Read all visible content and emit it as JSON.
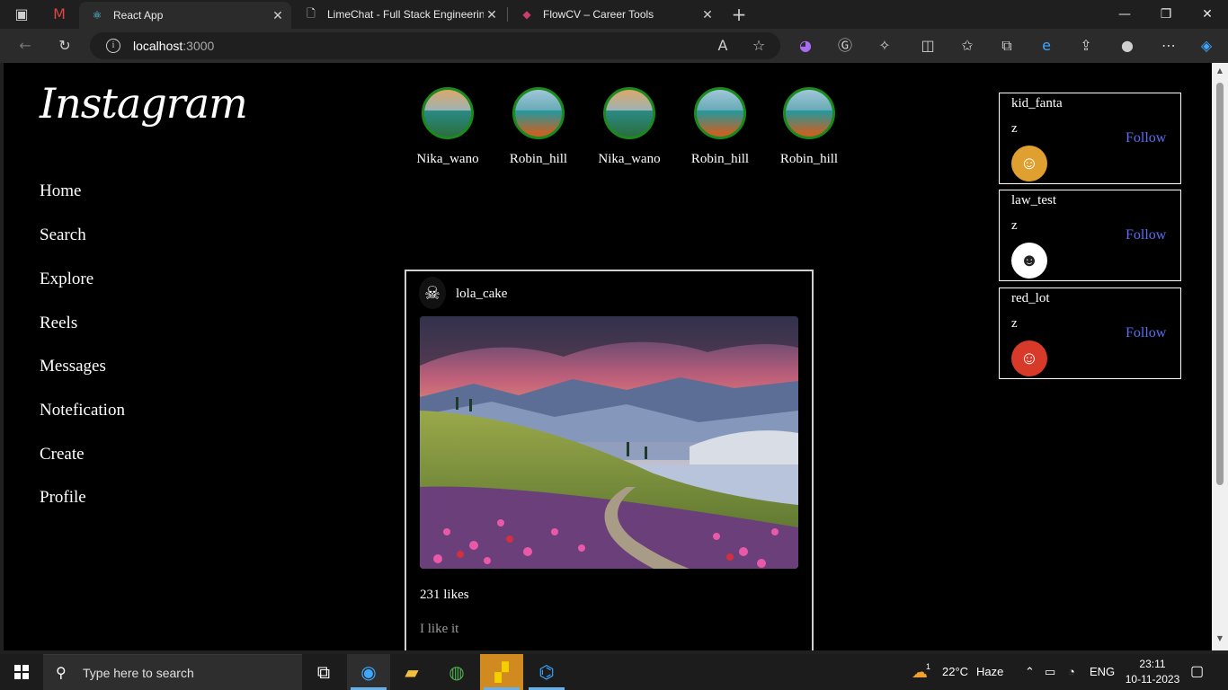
{
  "browser": {
    "tabs": [
      {
        "label": "React App",
        "active": true,
        "icon": "react-icon"
      },
      {
        "label": "LimeChat - Full Stack Engineering",
        "active": false,
        "icon": "document-icon"
      },
      {
        "label": "FlowCV – Career Tools",
        "active": false,
        "icon": "flowcv-icon"
      }
    ],
    "url_host": "localhost",
    "url_port": ":3000"
  },
  "app": {
    "logo": "Instagram",
    "nav": [
      "Home",
      "Search",
      "Explore",
      "Reels",
      "Messages",
      "Notefication",
      "Create",
      "Profile"
    ],
    "stories": [
      "Nika_wano",
      "Robin_hill",
      "Nika_wano",
      "Robin_hill",
      "Robin_hill"
    ],
    "post": {
      "username": "lola_cake",
      "likes": "231 likes",
      "caption": "I like it"
    },
    "suggestions": [
      {
        "username": "kid_fanta",
        "name": "z",
        "action": "Follow"
      },
      {
        "username": "law_test",
        "name": "z",
        "action": "Follow"
      },
      {
        "username": "red_lot",
        "name": "z",
        "action": "Follow"
      }
    ],
    "colors": {
      "follow": "#5c6ef0",
      "story_ring": "#1a8a1a"
    }
  },
  "taskbar": {
    "search_placeholder": "Type here to search",
    "weather_temp": "22°C",
    "weather_desc": "Haze",
    "language": "ENG",
    "time": "23:11",
    "date": "10-11-2023",
    "weather_badge": "1"
  }
}
